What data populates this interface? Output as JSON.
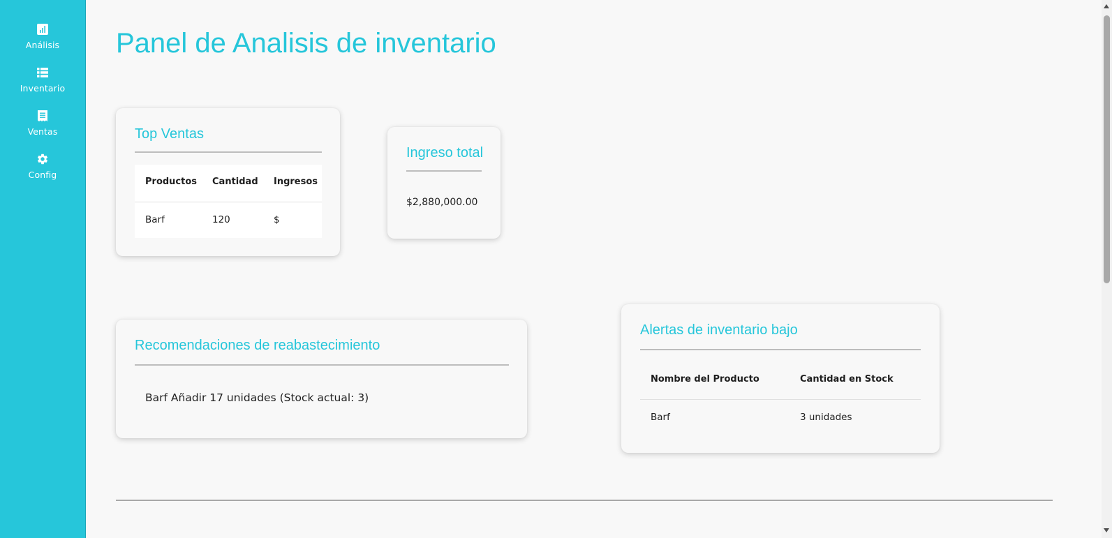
{
  "sidebar": {
    "items": [
      {
        "label": "Análisis",
        "icon": "analytics-icon"
      },
      {
        "label": "Inventario",
        "icon": "list-icon"
      },
      {
        "label": "Ventas",
        "icon": "receipt-icon"
      },
      {
        "label": "Config",
        "icon": "gear-icon"
      }
    ]
  },
  "page": {
    "title": "Panel de Analisis de inventario"
  },
  "top_ventas": {
    "title": "Top Ventas",
    "headers": [
      "Productos",
      "Cantidad",
      "Ingresos"
    ],
    "rows": [
      {
        "producto": "Barf",
        "cantidad": "120",
        "ingresos": "$"
      }
    ]
  },
  "ingreso_total": {
    "title": "Ingreso total",
    "value": "$2,880,000.00"
  },
  "recomendaciones": {
    "title": "Recomendaciones de reabastecimiento",
    "items": [
      "Barf Añadir 17 unidades (Stock actual: 3)"
    ]
  },
  "alertas": {
    "title": "Alertas de inventario bajo",
    "headers": [
      "Nombre del Producto",
      "Cantidad en Stock"
    ],
    "rows": [
      {
        "nombre": "Barf",
        "cantidad": "3 unidades"
      }
    ]
  },
  "colors": {
    "accent": "#26c6da",
    "background": "#f8f8f8",
    "text": "#222222"
  }
}
